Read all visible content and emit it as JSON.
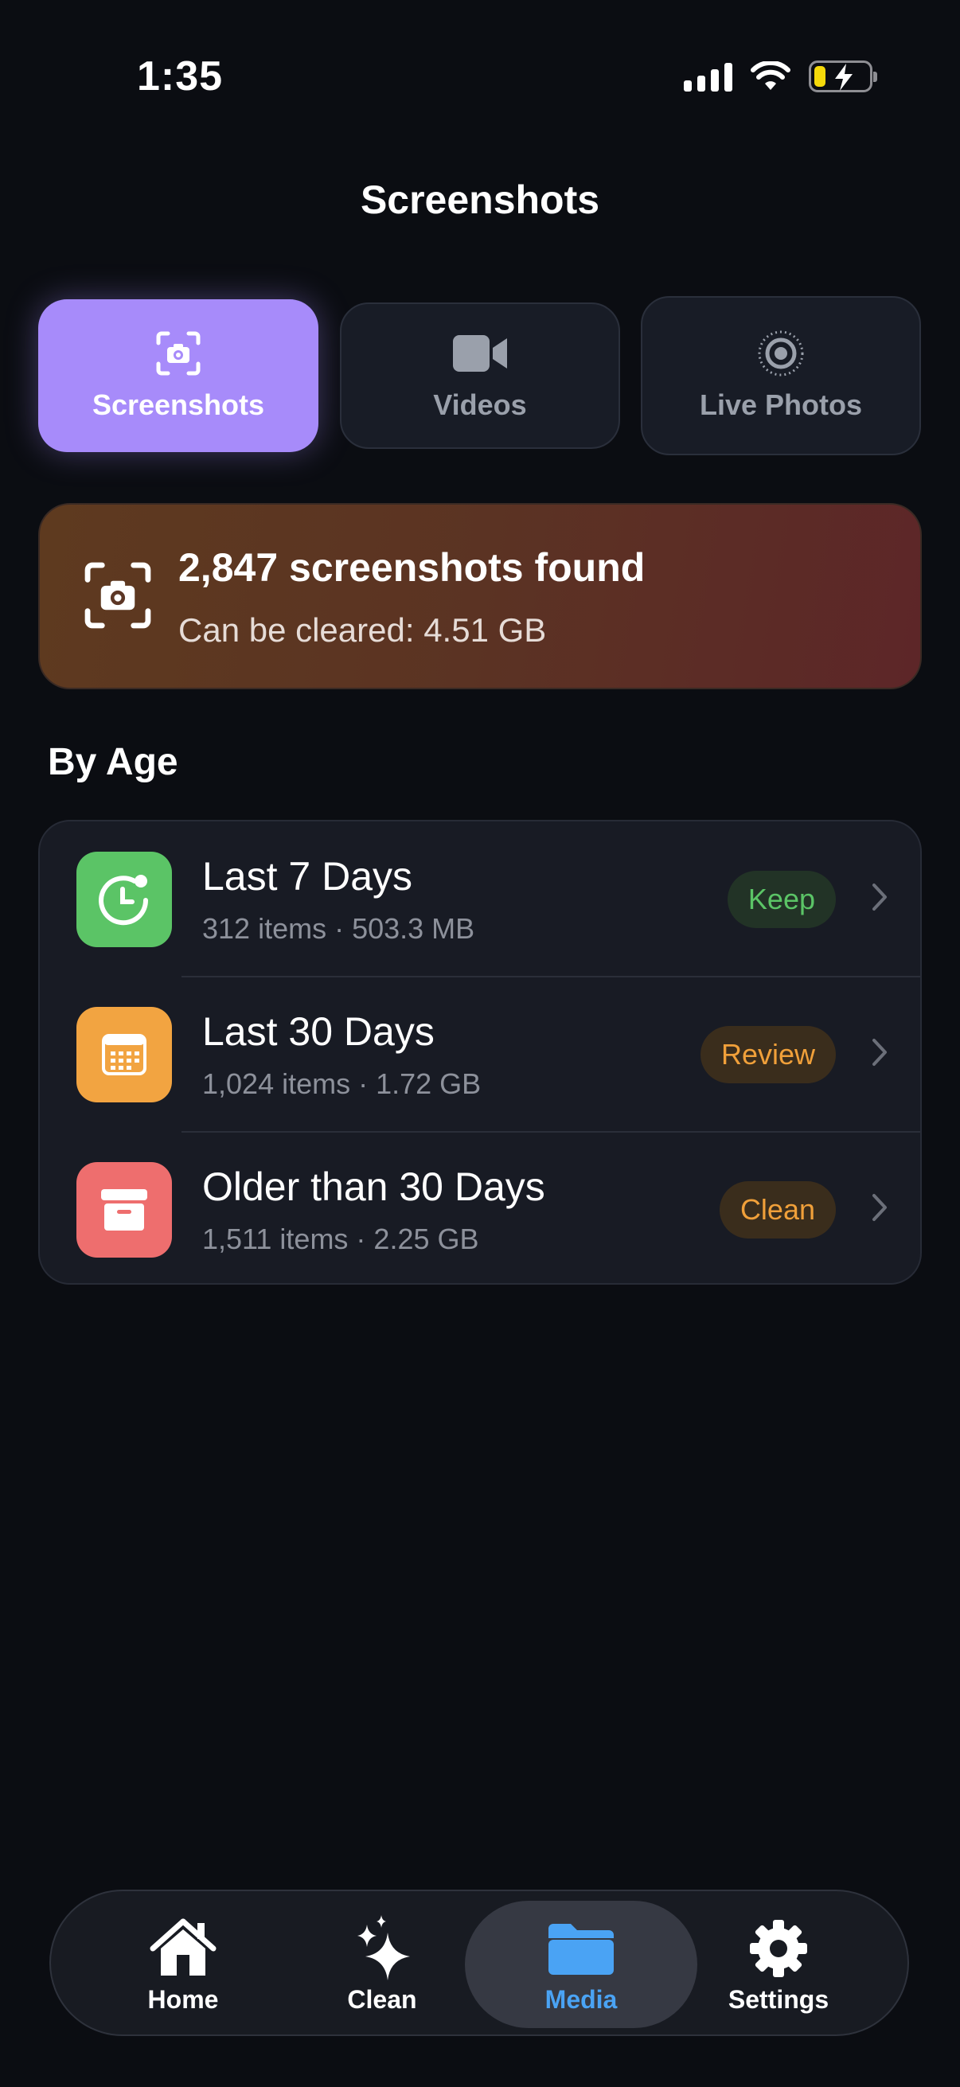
{
  "status_bar": {
    "time": "1:35"
  },
  "header": {
    "title": "Screenshots"
  },
  "tabs": [
    {
      "label": "Screenshots",
      "icon": "camera-viewfinder-icon",
      "active": true
    },
    {
      "label": "Videos",
      "icon": "video-camera-icon",
      "active": false
    },
    {
      "label": "Live Photos",
      "icon": "live-photo-icon",
      "active": false
    }
  ],
  "summary": {
    "icon": "camera-viewfinder-icon",
    "title": "2,847 screenshots found",
    "subtitle": "Can be cleared: 4.51 GB"
  },
  "section": {
    "title": "By Age"
  },
  "age_groups": [
    {
      "title": "Last 7 Days",
      "subtitle": "312 items · 503.3 MB",
      "badge": "Keep",
      "icon": "clock-badge-icon",
      "icon_color": "#5bc466",
      "badge_color": "#5bc466",
      "badge_bg": "#223326"
    },
    {
      "title": "Last 30 Days",
      "subtitle": "1,024 items · 1.72 GB",
      "badge": "Review",
      "icon": "calendar-icon",
      "icon_color": "#f2a441",
      "badge_color": "#f0a03a",
      "badge_bg": "#3a2d1c"
    },
    {
      "title": "Older than 30 Days",
      "subtitle": "1,511 items · 2.25 GB",
      "badge": "Clean",
      "icon": "archive-box-icon",
      "icon_color": "#ee6e6e",
      "badge_color": "#f0a03a",
      "badge_bg": "#3a2d1c"
    }
  ],
  "bottom_nav": [
    {
      "label": "Home",
      "icon": "house-icon",
      "active": false
    },
    {
      "label": "Clean",
      "icon": "sparkles-icon",
      "active": false
    },
    {
      "label": "Media",
      "icon": "folder-icon",
      "active": true
    },
    {
      "label": "Settings",
      "icon": "gear-icon",
      "active": false
    }
  ],
  "colors": {
    "background": "#0b0d12",
    "accent_purple": "#a78bfa",
    "nav_active": "#4aa3f4"
  }
}
